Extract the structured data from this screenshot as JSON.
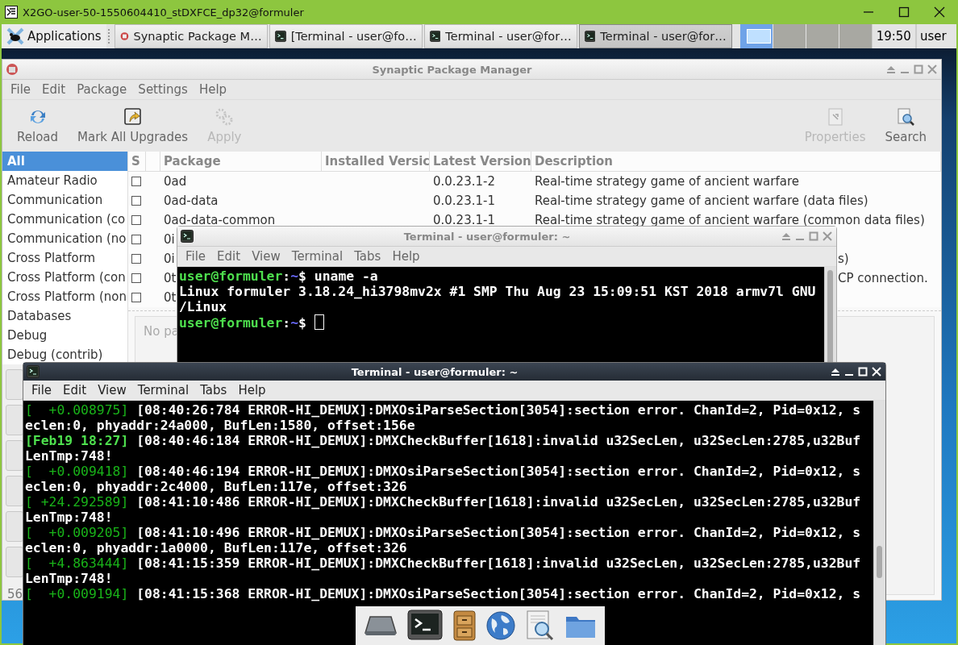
{
  "x2go_window": {
    "title": "X2GO-user-50-1550604410_stDXFCE_dp32@formuler"
  },
  "taskbar": {
    "menu": "Applications",
    "tasks": [
      {
        "label": "Synaptic Package M…",
        "kind": "synaptic",
        "selected": false
      },
      {
        "label": "[Terminal - user@fo…",
        "kind": "terminal",
        "selected": false
      },
      {
        "label": "Terminal - user@for…",
        "kind": "terminal",
        "selected": false
      },
      {
        "label": "Terminal - user@for…",
        "kind": "terminal",
        "selected": true
      }
    ],
    "workspaces": [
      {
        "selected": true
      },
      {
        "selected": false
      },
      {
        "selected": false
      },
      {
        "selected": false
      }
    ],
    "clock": "19:50",
    "user": "user"
  },
  "synaptic": {
    "title": "Synaptic Package Manager",
    "menu": [
      "File",
      "Edit",
      "Package",
      "Settings",
      "Help"
    ],
    "toolbar": [
      {
        "label": "Reload",
        "kind": "reload",
        "disabled": false
      },
      {
        "label": "Mark All Upgrades",
        "kind": "upgrade",
        "disabled": false
      },
      {
        "label": "Apply",
        "kind": "apply",
        "disabled": true
      },
      {
        "label": "Properties",
        "kind": "properties",
        "disabled": true
      },
      {
        "label": "Search",
        "kind": "search",
        "disabled": false
      }
    ],
    "categories": [
      {
        "label": "All",
        "selected": true
      },
      {
        "label": "Amateur Radio",
        "selected": false
      },
      {
        "label": "Communication",
        "selected": false
      },
      {
        "label": "Communication (co",
        "selected": false
      },
      {
        "label": "Communication (no",
        "selected": false
      },
      {
        "label": "Cross Platform",
        "selected": false
      },
      {
        "label": "Cross Platform (con",
        "selected": false
      },
      {
        "label": "Cross Platform (non",
        "selected": false
      },
      {
        "label": "Databases",
        "selected": false
      },
      {
        "label": "Debug",
        "selected": false
      },
      {
        "label": "Debug (contrib)",
        "selected": false
      }
    ],
    "columns": [
      "S",
      "Package",
      "Installed Versic",
      "Latest Version",
      "Description"
    ],
    "packages": [
      {
        "checked": false,
        "package": "0ad",
        "latest": "0.0.23.1-2",
        "description": "Real-time strategy game of ancient warfare"
      },
      {
        "checked": false,
        "package": "0ad-data",
        "latest": "0.0.23.1-1",
        "description": "Real-time strategy game of ancient warfare (data files)"
      },
      {
        "checked": false,
        "package": "0ad-data-common",
        "latest": "0.0.23.1-1",
        "description": "Real-time strategy game of ancient warfare (common data files)"
      },
      {
        "checked": false,
        "package": "0i"
      },
      {
        "checked": false,
        "package": "0i",
        "description_tail": "s)"
      },
      {
        "checked": false,
        "package": "0t",
        "description_tail": "CP connection."
      },
      {
        "checked": false,
        "package": "0t"
      }
    ],
    "details": "No pa",
    "status": "56"
  },
  "terminal_back": {
    "title": "Terminal - user@formuler: ~",
    "menu": [
      "File",
      "Edit",
      "View",
      "Terminal",
      "Tabs",
      "Help"
    ],
    "lines": [
      {
        "kind": "prompt",
        "user": "user@formuler",
        "colon": ":",
        "path": "~",
        "command": "$ uname -a",
        "cursor": false
      },
      {
        "kind": "output",
        "text": "Linux formuler 3.18.24_hi3798mv2x #1 SMP Thu Aug 23 15:09:51 KST 2018 armv7l GNU"
      },
      {
        "kind": "output",
        "text": "/Linux"
      },
      {
        "kind": "prompt",
        "user": "user@formuler",
        "colon": ":",
        "path": "~",
        "command": "$ ",
        "cursor": true
      }
    ]
  },
  "terminal_front": {
    "title": "Terminal - user@formuler: ~",
    "menu": [
      "File",
      "Edit",
      "View",
      "Terminal",
      "Tabs",
      "Help"
    ],
    "lines": [
      {
        "stamp": "[  +0.008975]",
        "bright": false,
        "text": " [08:40:26:784 ERROR-HI_DEMUX]:DMXOsiParseSection[3054]:section error. ChanId=2, Pid=0x12, s"
      },
      {
        "text": "eclen:0, phyaddr:24a000, BufLen:1580, offset:156e"
      },
      {
        "stamp": "[Feb19 18:27]",
        "bright": true,
        "text": " [08:40:46:184 ERROR-HI_DEMUX]:DMXCheckBuffer[1618]:invalid u32SecLen, u32SecLen:2785,u32Buf"
      },
      {
        "text": "LenTmp:748!"
      },
      {
        "stamp": "[  +0.009418]",
        "bright": false,
        "text": " [08:40:46:194 ERROR-HI_DEMUX]:DMXOsiParseSection[3054]:section error. ChanId=2, Pid=0x12, s"
      },
      {
        "text": "eclen:0, phyaddr:2c4000, BufLen:117e, offset:326"
      },
      {
        "stamp": "[ +24.292589]",
        "bright": false,
        "text": " [08:41:10:486 ERROR-HI_DEMUX]:DMXCheckBuffer[1618]:invalid u32SecLen, u32SecLen:2785,u32Buf"
      },
      {
        "text": "LenTmp:748!"
      },
      {
        "stamp": "[  +0.009205]",
        "bright": false,
        "text": " [08:41:10:496 ERROR-HI_DEMUX]:DMXOsiParseSection[3054]:section error. ChanId=2, Pid=0x12, s"
      },
      {
        "text": "eclen:0, phyaddr:1a0000, BufLen:117e, offset:326"
      },
      {
        "stamp": "[  +4.863444]",
        "bright": false,
        "text": " [08:41:15:359 ERROR-HI_DEMUX]:DMXCheckBuffer[1618]:invalid u32SecLen, u32SecLen:2785,u32Buf"
      },
      {
        "text": "LenTmp:748!"
      },
      {
        "stamp": "[  +0.009194]",
        "bright": false,
        "text": " [08:41:15:368 ERROR-HI_DEMUX]:DMXOsiParseSection[3054]:section error. ChanId=2, Pid=0x12, s"
      }
    ]
  },
  "dock": [
    {
      "kind": "drive"
    },
    {
      "kind": "terminal"
    },
    {
      "kind": "cabinet"
    },
    {
      "kind": "globe"
    },
    {
      "kind": "finder"
    },
    {
      "kind": "folder"
    }
  ]
}
